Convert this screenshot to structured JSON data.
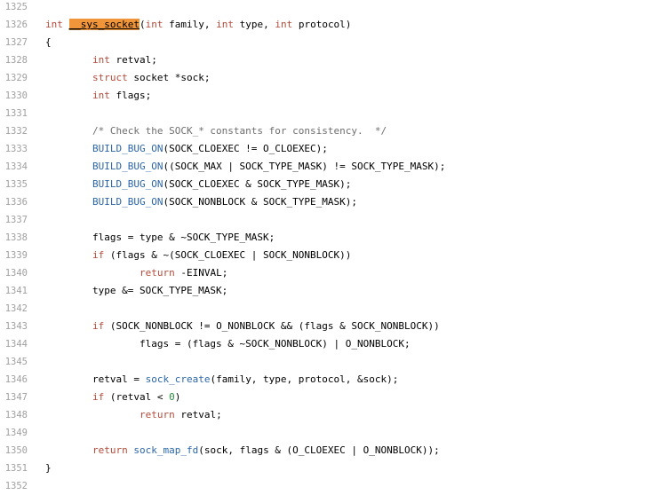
{
  "code_view": {
    "highlighted_symbol": "__sys_socket",
    "lines": [
      {
        "num": "1325",
        "code": []
      },
      {
        "num": "1326",
        "code": [
          [
            "kw",
            "int"
          ],
          [
            "p",
            " "
          ],
          [
            "hl",
            "__sys_socket"
          ],
          [
            "p",
            "("
          ],
          [
            "kw",
            "int"
          ],
          [
            "p",
            " family, "
          ],
          [
            "kw",
            "int"
          ],
          [
            "p",
            " type, "
          ],
          [
            "kw",
            "int"
          ],
          [
            "p",
            " protocol)"
          ]
        ]
      },
      {
        "num": "1327",
        "code": [
          [
            "p",
            "{"
          ]
        ]
      },
      {
        "num": "1328",
        "code": [
          [
            "p",
            "        "
          ],
          [
            "kw",
            "int"
          ],
          [
            "p",
            " retval;"
          ]
        ]
      },
      {
        "num": "1329",
        "code": [
          [
            "p",
            "        "
          ],
          [
            "kw",
            "struct"
          ],
          [
            "p",
            " socket *sock;"
          ]
        ]
      },
      {
        "num": "1330",
        "code": [
          [
            "p",
            "        "
          ],
          [
            "kw",
            "int"
          ],
          [
            "p",
            " flags;"
          ]
        ]
      },
      {
        "num": "1331",
        "code": []
      },
      {
        "num": "1332",
        "code": [
          [
            "p",
            "        "
          ],
          [
            "cm",
            "/* Check the SOCK_* constants for consistency.  */"
          ]
        ]
      },
      {
        "num": "1333",
        "code": [
          [
            "p",
            "        "
          ],
          [
            "mac",
            "BUILD_BUG_ON"
          ],
          [
            "p",
            "(SOCK_CLOEXEC != O_CLOEXEC);"
          ]
        ]
      },
      {
        "num": "1334",
        "code": [
          [
            "p",
            "        "
          ],
          [
            "mac",
            "BUILD_BUG_ON"
          ],
          [
            "p",
            "((SOCK_MAX | SOCK_TYPE_MASK) != SOCK_TYPE_MASK);"
          ]
        ]
      },
      {
        "num": "1335",
        "code": [
          [
            "p",
            "        "
          ],
          [
            "mac",
            "BUILD_BUG_ON"
          ],
          [
            "p",
            "(SOCK_CLOEXEC & SOCK_TYPE_MASK);"
          ]
        ]
      },
      {
        "num": "1336",
        "code": [
          [
            "p",
            "        "
          ],
          [
            "mac",
            "BUILD_BUG_ON"
          ],
          [
            "p",
            "(SOCK_NONBLOCK & SOCK_TYPE_MASK);"
          ]
        ]
      },
      {
        "num": "1337",
        "code": []
      },
      {
        "num": "1338",
        "code": [
          [
            "p",
            "        flags = type & ~SOCK_TYPE_MASK;"
          ]
        ]
      },
      {
        "num": "1339",
        "code": [
          [
            "p",
            "        "
          ],
          [
            "kw",
            "if"
          ],
          [
            "p",
            " (flags & ~(SOCK_CLOEXEC | SOCK_NONBLOCK))"
          ]
        ]
      },
      {
        "num": "1340",
        "code": [
          [
            "p",
            "                "
          ],
          [
            "kw",
            "return"
          ],
          [
            "p",
            " -EINVAL;"
          ]
        ]
      },
      {
        "num": "1341",
        "code": [
          [
            "p",
            "        type &= SOCK_TYPE_MASK;"
          ]
        ]
      },
      {
        "num": "1342",
        "code": []
      },
      {
        "num": "1343",
        "code": [
          [
            "p",
            "        "
          ],
          [
            "kw",
            "if"
          ],
          [
            "p",
            " (SOCK_NONBLOCK != O_NONBLOCK && (flags & SOCK_NONBLOCK))"
          ]
        ]
      },
      {
        "num": "1344",
        "code": [
          [
            "p",
            "                flags = (flags & ~SOCK_NONBLOCK) | O_NONBLOCK;"
          ]
        ]
      },
      {
        "num": "1345",
        "code": []
      },
      {
        "num": "1346",
        "code": [
          [
            "p",
            "        retval = "
          ],
          [
            "fn",
            "sock_create"
          ],
          [
            "p",
            "(family, type, protocol, &sock);"
          ]
        ]
      },
      {
        "num": "1347",
        "code": [
          [
            "p",
            "        "
          ],
          [
            "kw",
            "if"
          ],
          [
            "p",
            " (retval < "
          ],
          [
            "num",
            "0"
          ],
          [
            "p",
            ")"
          ]
        ]
      },
      {
        "num": "1348",
        "code": [
          [
            "p",
            "                "
          ],
          [
            "kw",
            "return"
          ],
          [
            "p",
            " retval;"
          ]
        ]
      },
      {
        "num": "1349",
        "code": []
      },
      {
        "num": "1350",
        "code": [
          [
            "p",
            "        "
          ],
          [
            "kw",
            "return"
          ],
          [
            "p",
            " "
          ],
          [
            "fn",
            "sock_map_fd"
          ],
          [
            "p",
            "(sock, flags & (O_CLOEXEC | O_NONBLOCK));"
          ]
        ]
      },
      {
        "num": "1351",
        "code": [
          [
            "p",
            "}"
          ]
        ]
      },
      {
        "num": "1352",
        "code": []
      }
    ]
  },
  "colors": {
    "keyword": "#b34a3a",
    "macro": "#2b66a8",
    "comment": "#6e6e6e",
    "number": "#2b8a3e",
    "highlight": "#f0953a",
    "line_number": "#a0a0a0"
  }
}
